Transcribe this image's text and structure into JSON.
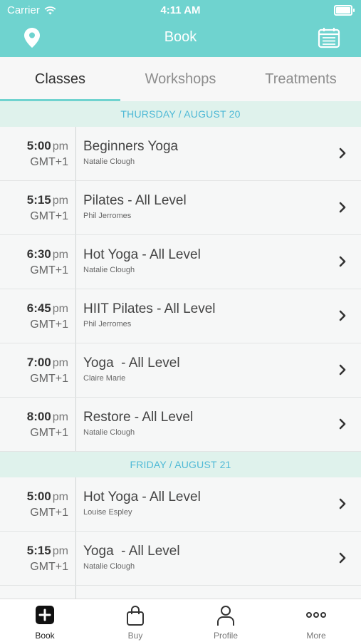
{
  "status": {
    "carrier": "Carrier",
    "time": "4:11 AM"
  },
  "header": {
    "title": "Book",
    "left_icon": "location-pin-icon",
    "right_icon": "calendar-icon"
  },
  "tabs": [
    {
      "label": "Classes",
      "active": true
    },
    {
      "label": "Workshops",
      "active": false
    },
    {
      "label": "Treatments",
      "active": false
    }
  ],
  "days": [
    {
      "label": "THURSDAY / AUGUST 20",
      "classes": [
        {
          "time": "5:00",
          "ampm": "pm",
          "tz": "GMT+1",
          "name": "Beginners Yoga",
          "teacher": "Natalie Clough"
        },
        {
          "time": "5:15",
          "ampm": "pm",
          "tz": "GMT+1",
          "name": "Pilates - All Level",
          "teacher": "Phil Jerromes"
        },
        {
          "time": "6:30",
          "ampm": "pm",
          "tz": "GMT+1",
          "name": "Hot Yoga - All Level",
          "teacher": "Natalie Clough"
        },
        {
          "time": "6:45",
          "ampm": "pm",
          "tz": "GMT+1",
          "name": "HIIT Pilates - All Level",
          "teacher": "Phil Jerromes"
        },
        {
          "time": "7:00",
          "ampm": "pm",
          "tz": "GMT+1",
          "name": "Yoga  - All Level",
          "teacher": "Claire Marie"
        },
        {
          "time": "8:00",
          "ampm": "pm",
          "tz": "GMT+1",
          "name": "Restore - All Level",
          "teacher": "Natalie Clough"
        }
      ]
    },
    {
      "label": "FRIDAY / AUGUST 21",
      "classes": [
        {
          "time": "5:00",
          "ampm": "pm",
          "tz": "GMT+1",
          "name": "Hot Yoga - All Level",
          "teacher": "Louise Espley"
        },
        {
          "time": "5:15",
          "ampm": "pm",
          "tz": "GMT+1",
          "name": "Yoga  - All Level",
          "teacher": "Natalie Clough"
        }
      ]
    }
  ],
  "bottom_nav": [
    {
      "label": "Book",
      "icon": "plus-square-icon",
      "active": true
    },
    {
      "label": "Buy",
      "icon": "shopping-bag-icon",
      "active": false
    },
    {
      "label": "Profile",
      "icon": "person-icon",
      "active": false
    },
    {
      "label": "More",
      "icon": "more-dots-icon",
      "active": false
    }
  ],
  "colors": {
    "accent": "#6fd3cf",
    "day_header_bg": "#dff2ec",
    "day_header_text": "#4fb9d6"
  }
}
